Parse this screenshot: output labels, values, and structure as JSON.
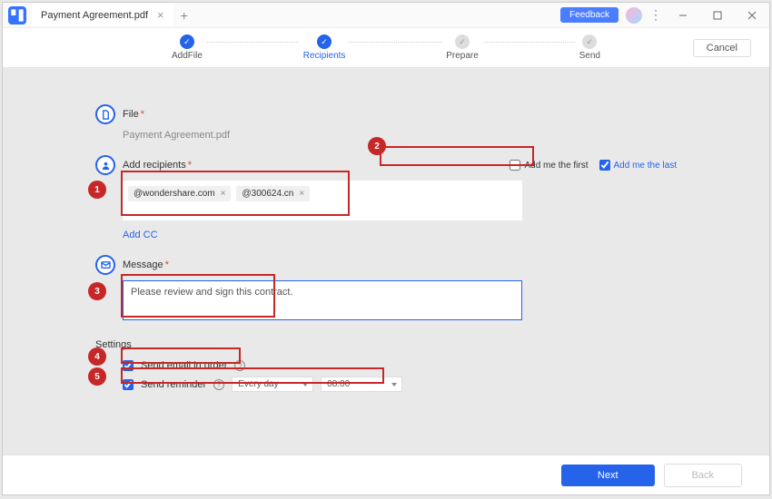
{
  "titlebar": {
    "tab_title": "Payment Agreement.pdf",
    "feedback": "Feedback"
  },
  "toolbar": {
    "steps": [
      "AddFile",
      "Recipients",
      "Prepare",
      "Send"
    ],
    "cancel": "Cancel"
  },
  "file": {
    "label": "File",
    "name": "Payment Agreement.pdf"
  },
  "recipients": {
    "label": "Add recipients",
    "chips": [
      "@wondershare.com",
      "@300624.cn"
    ],
    "add_me_first": "Add me the first",
    "add_me_last": "Add me the last",
    "add_cc": "Add CC"
  },
  "message": {
    "label": "Message",
    "text": "Please review and sign this contract."
  },
  "settings": {
    "label": "Settings",
    "send_in_order": "Send email in order",
    "send_reminder": "Send reminder",
    "freq": "Every day",
    "time": "08:00"
  },
  "footer": {
    "next": "Next",
    "back": "Back"
  },
  "callouts": [
    "1",
    "2",
    "3",
    "4",
    "5"
  ]
}
